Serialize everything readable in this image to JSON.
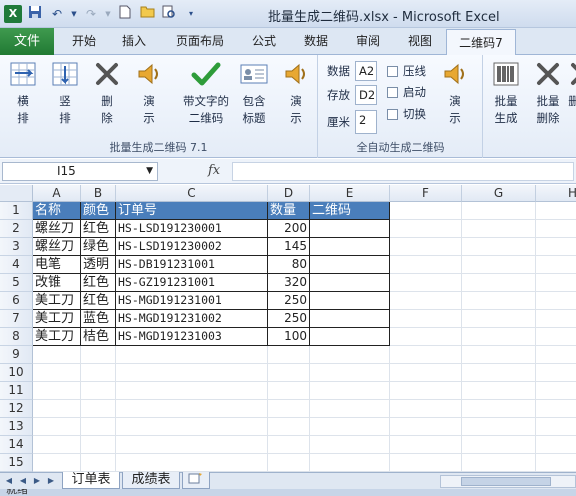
{
  "titlebar": {
    "title": "批量生成二维码.xlsx - Microsoft Excel",
    "excel_icon": "X",
    "qat_icons": [
      "save-icon",
      "undo-icon",
      "redo-icon",
      "new-icon",
      "open-icon",
      "print-preview-icon",
      "customize-icon"
    ]
  },
  "tabs": {
    "file": "文件",
    "items": [
      "开始",
      "插入",
      "页面布局",
      "公式",
      "数据",
      "审阅",
      "视图",
      "二维码7"
    ],
    "active": "二维码7"
  },
  "ribbon": {
    "group1": {
      "label": "批量生成二维码 7.1",
      "buttons": [
        {
          "label": "横\n排",
          "icon": "horizontal-layout-icon"
        },
        {
          "label": "竖\n排",
          "icon": "vertical-layout-icon"
        },
        {
          "label": "删\n除",
          "icon": "delete-x-icon"
        },
        {
          "label": "演\n示",
          "icon": "speaker-icon"
        },
        {
          "label": "带文字的\n二维码",
          "icon": "checkmark-icon"
        },
        {
          "label": "包含\n标题",
          "icon": "id-card-icon"
        },
        {
          "label": "演\n示",
          "icon": "speaker-icon"
        }
      ]
    },
    "group2": {
      "label": "全自动生成二维码",
      "fields": [
        {
          "label": "数据",
          "value": "A2"
        },
        {
          "label": "存放",
          "value": "D2"
        },
        {
          "label": "厘米",
          "value": "2"
        }
      ],
      "checkboxes": [
        "压线",
        "启动",
        "切换"
      ],
      "demo": {
        "label": "演\n示",
        "icon": "speaker-icon"
      }
    },
    "group3": {
      "buttons": [
        {
          "label": "批量\n生成",
          "icon": "barcode-icon"
        },
        {
          "label": "批量\n删除",
          "icon": "delete-x-icon"
        },
        {
          "label": "删",
          "icon": "delete-x-icon"
        }
      ]
    }
  },
  "formula_bar": {
    "name_box": "I15",
    "fx": "fx",
    "formula": ""
  },
  "grid": {
    "columns": [
      "A",
      "B",
      "C",
      "D",
      "E",
      "F",
      "G",
      "H"
    ],
    "rows": [
      "1",
      "2",
      "3",
      "4",
      "5",
      "6",
      "7",
      "8",
      "9",
      "10",
      "11",
      "12",
      "13",
      "14",
      "15"
    ],
    "header_row": [
      "名称",
      "颜色",
      "订单号",
      "数量",
      "二维码"
    ],
    "data_rows": [
      [
        "螺丝刀",
        "红色",
        "HS-LSD191230001",
        "200",
        ""
      ],
      [
        "螺丝刀",
        "绿色",
        "HS-LSD191230002",
        "145",
        ""
      ],
      [
        "电笔",
        "透明",
        "HS-DB191231001",
        "80",
        ""
      ],
      [
        "改锥",
        "红色",
        "HS-GZ191231001",
        "320",
        ""
      ],
      [
        "美工刀",
        "红色",
        "HS-MGD191231001",
        "250",
        ""
      ],
      [
        "美工刀",
        "蓝色",
        "HS-MGD191231002",
        "250",
        ""
      ],
      [
        "美工刀",
        "桔色",
        "HS-MGD191231003",
        "100",
        ""
      ]
    ],
    "header_color": "#4a7ebb"
  },
  "sheets": {
    "tabs": [
      "订单表",
      "成绩表"
    ],
    "active": "订单表"
  },
  "status": {
    "text": "就绪"
  }
}
